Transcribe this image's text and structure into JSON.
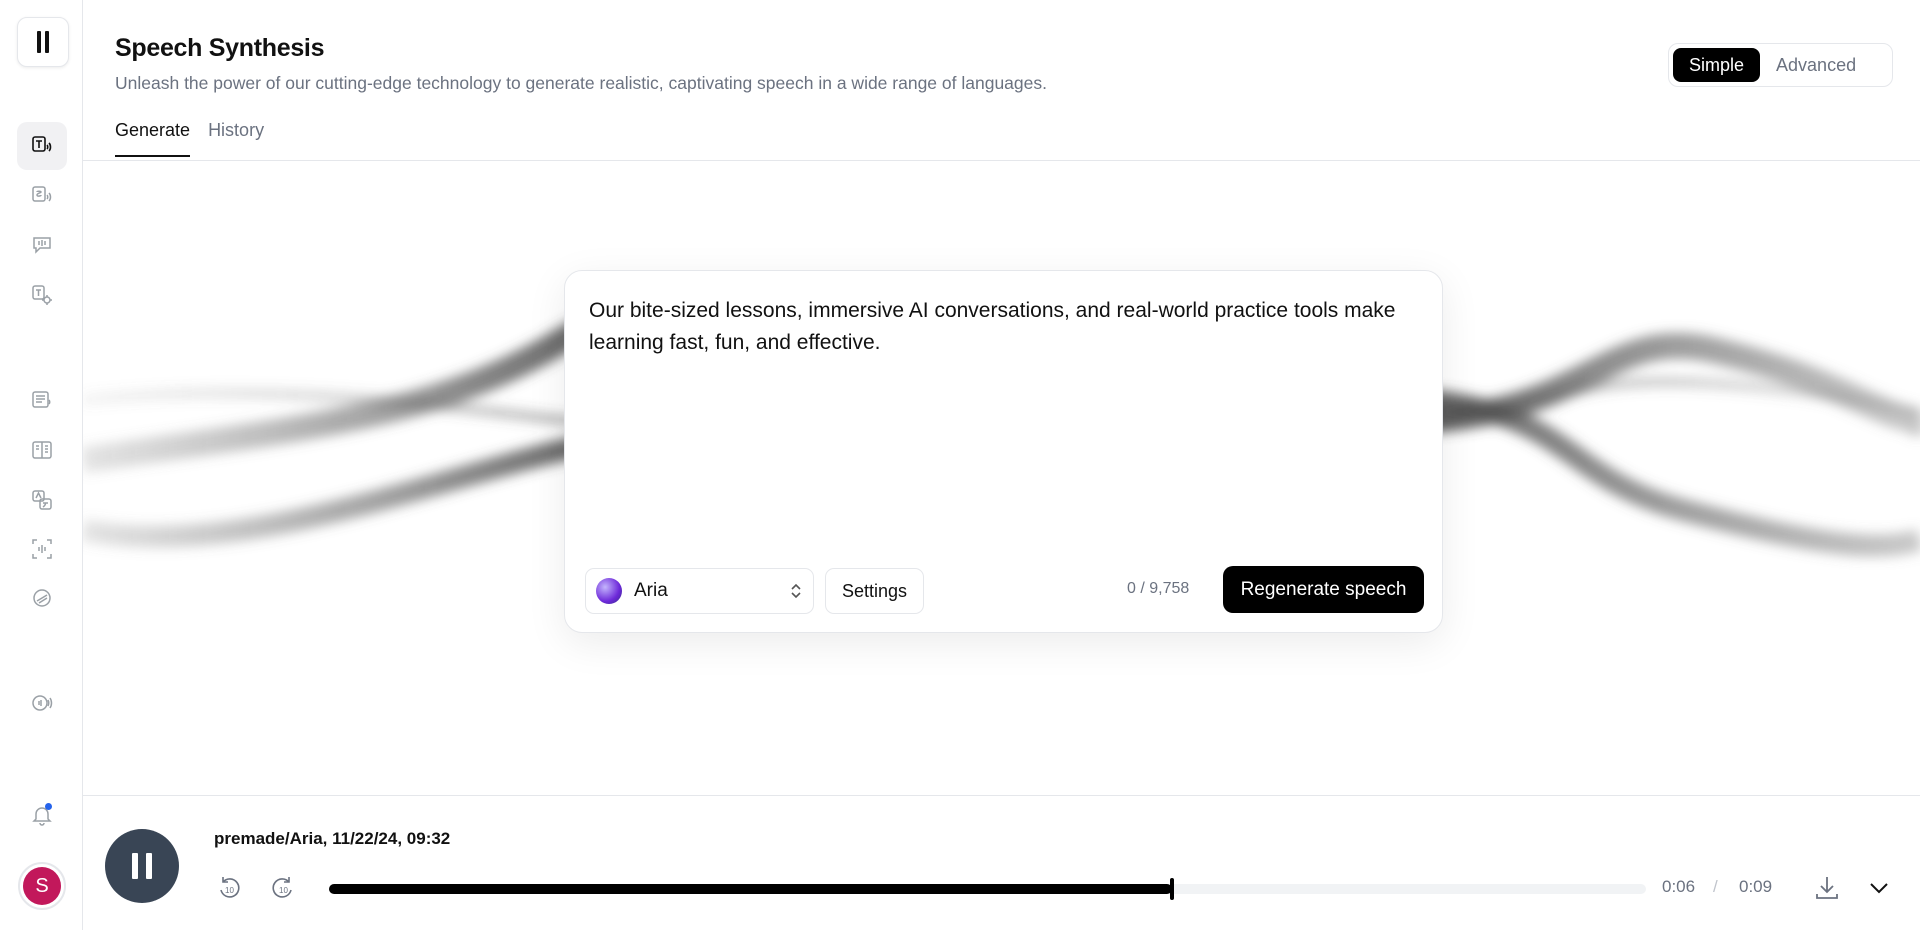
{
  "app": {
    "title": "Speech Synthesis",
    "subtitle": "Unleash the power of our cutting-edge technology to generate realistic, captivating speech in a wide range of languages."
  },
  "mode_toggle": {
    "options": [
      "Simple",
      "Advanced"
    ],
    "selected": "Simple"
  },
  "tabs": [
    {
      "label": "Generate",
      "active": true
    },
    {
      "label": "History",
      "active": false
    }
  ],
  "sidebar": {
    "items": [
      {
        "icon": "text-to-speech-icon",
        "active": true
      },
      {
        "icon": "speech-to-speech-icon",
        "active": false
      },
      {
        "icon": "voice-chat-icon",
        "active": false
      },
      {
        "icon": "voice-settings-icon",
        "active": false
      },
      {
        "icon": "projects-icon",
        "active": false
      },
      {
        "icon": "reader-icon",
        "active": false
      },
      {
        "icon": "dubbing-icon",
        "active": false
      },
      {
        "icon": "voice-isolator-icon",
        "active": false
      },
      {
        "icon": "voice-library-icon",
        "active": false
      },
      {
        "icon": "audio-native-icon",
        "active": false
      }
    ],
    "notification_icon": "bell-icon",
    "avatar_initial": "S",
    "avatar_color": "#c2185b"
  },
  "editor": {
    "text": "Our bite-sized lessons, immersive AI conversations, and real-world practice tools make learning fast, fun, and effective.",
    "voice": "Aria",
    "settings_label": "Settings",
    "char_count": "0 / 9,758",
    "regenerate_label": "Regenerate speech"
  },
  "player": {
    "track_title": "premade/Aria, 11/22/24, 09:32",
    "current_time": "0:06",
    "separator": "/",
    "total_time": "0:09",
    "progress_fraction": 0.64,
    "state": "playing"
  },
  "colors": {
    "accent": "#000000",
    "player_button": "#394555",
    "notification_dot": "#2563eb"
  }
}
